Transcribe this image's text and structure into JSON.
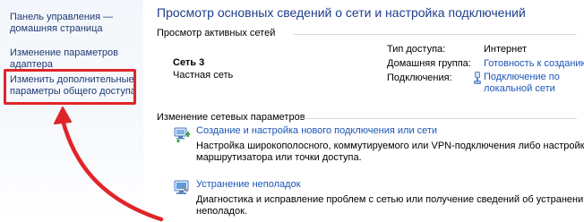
{
  "sidebar": {
    "items": [
      {
        "lines": [
          "Панель управления —",
          "домашняя страница"
        ]
      },
      {
        "lines": [
          "Изменение параметров",
          "адаптера"
        ]
      },
      {
        "lines": [
          "Изменить дополнительные",
          "параметры общего доступа"
        ]
      }
    ]
  },
  "main": {
    "title": "Просмотр основных сведений о сети и настройка подключений",
    "active_networks": {
      "header": "Просмотр активных сетей",
      "network_name": "Сеть 3",
      "network_type": "Частная сеть",
      "access_type_label": "Тип доступа:",
      "access_type_value": "Интернет",
      "homegroup_label": "Домашняя группа:",
      "homegroup_value": "Готовность к созданию",
      "connections_label": "Подключения:",
      "connections_value": [
        "Подключение по",
        "локальной сети"
      ]
    },
    "change_settings": {
      "header": "Изменение сетевых параметров",
      "tasks": [
        {
          "icon": "network-setup-icon",
          "link": "Создание и настройка нового подключения или сети",
          "description": [
            "Настройка широкополосного, коммутируемого или VPN-подключения либо настройка",
            "маршрутизатора или точки доступа."
          ]
        },
        {
          "icon": "troubleshoot-icon",
          "link": "Устранение неполадок",
          "description": [
            "Диагностика и исправление проблем с сетью или получение сведений об устранении",
            "неполадок."
          ]
        }
      ]
    }
  },
  "annotation": {
    "color": "#e0252a"
  }
}
